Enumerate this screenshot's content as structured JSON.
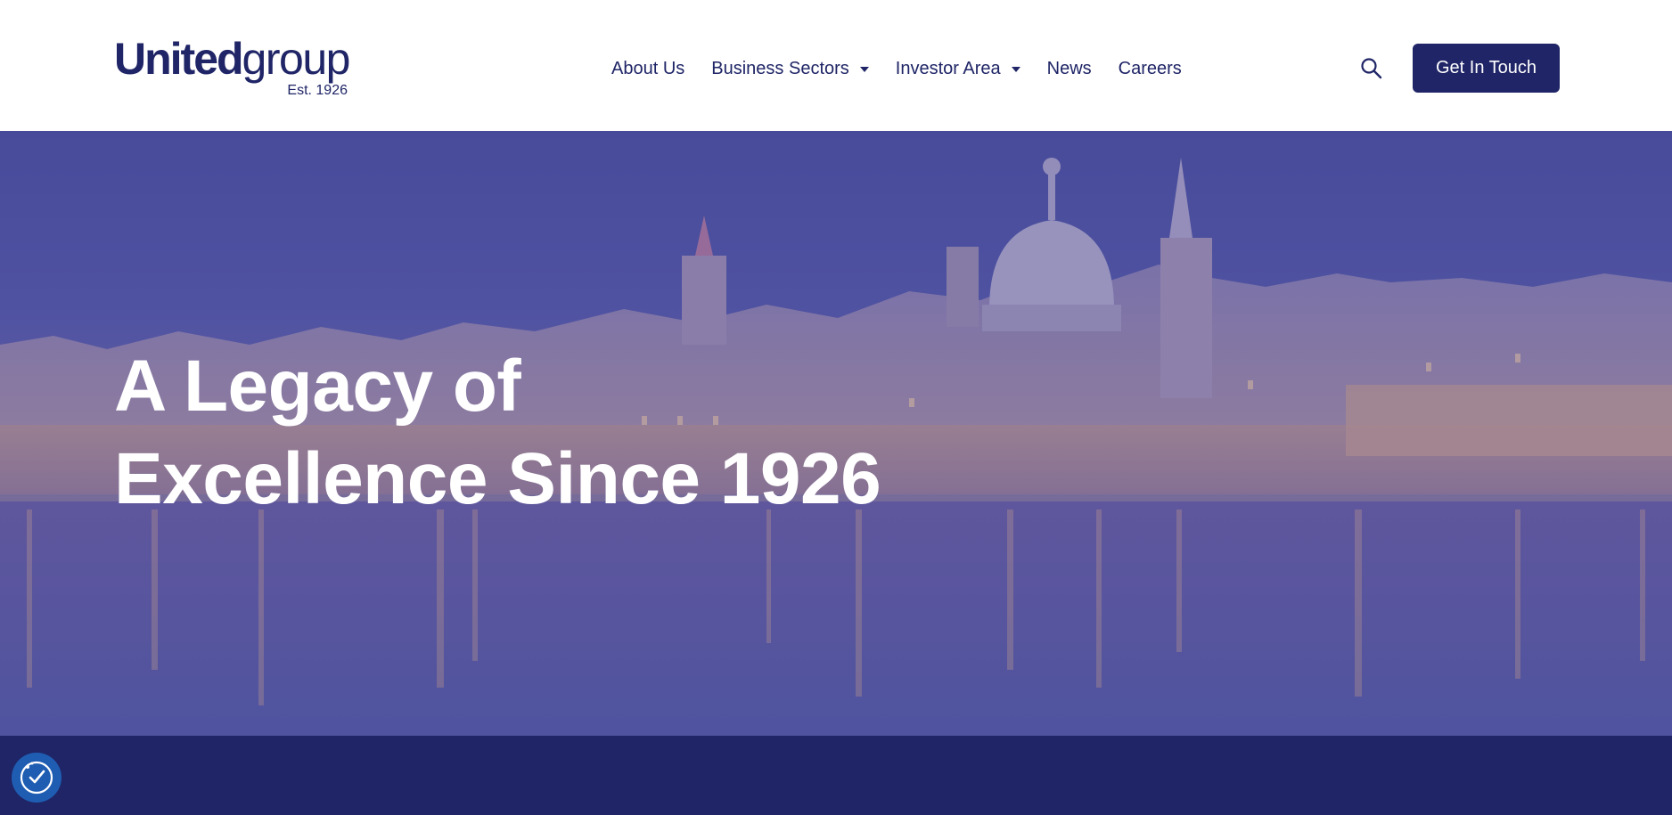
{
  "brand": {
    "name_bold": "United",
    "name_light": "group",
    "established": "Est. 1926",
    "primary_color": "#1f2566",
    "accent_color": "#1f5db3"
  },
  "nav": {
    "items": [
      {
        "label": "About Us",
        "has_dropdown": false
      },
      {
        "label": "Business Sectors",
        "has_dropdown": true
      },
      {
        "label": "Investor Area",
        "has_dropdown": true
      },
      {
        "label": "News",
        "has_dropdown": false
      },
      {
        "label": "Careers",
        "has_dropdown": false
      }
    ]
  },
  "header": {
    "search_icon": "search-icon",
    "cta_label": "Get In Touch"
  },
  "hero": {
    "title_line1": "A Legacy of",
    "title_line2": "Excellence Since 1926",
    "image_subject": "city-skyline-at-dusk"
  },
  "accessibility": {
    "icon": "accessibility-icon"
  }
}
